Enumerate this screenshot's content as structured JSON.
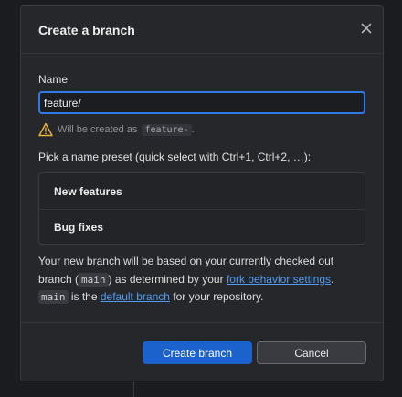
{
  "dialog": {
    "title": "Create a branch",
    "close_icon": "close-icon"
  },
  "name": {
    "label": "Name",
    "value": "feature/"
  },
  "hint": {
    "icon": "warning-icon",
    "prefix": "Will be created as",
    "code": "feature-",
    "suffix": "."
  },
  "presets": {
    "label": "Pick a name preset (quick select with Ctrl+1, Ctrl+2, …):",
    "items": [
      {
        "label": "New features"
      },
      {
        "label": "Bug fixes"
      }
    ]
  },
  "info": {
    "part1": "Your new branch will be based on your currently checked out branch (",
    "code1": "main",
    "part2": ") as determined by your ",
    "link1": "fork behavior settings",
    "part3": ". ",
    "code2": "main",
    "part4": " is the ",
    "link2": "default branch",
    "part5": " for your repository."
  },
  "buttons": {
    "create": "Create branch",
    "cancel": "Cancel"
  },
  "colors": {
    "accent": "#2f7ae5",
    "primary_button": "#1b62cc",
    "link": "#4f9cf0",
    "warning": "#e8b53a"
  }
}
